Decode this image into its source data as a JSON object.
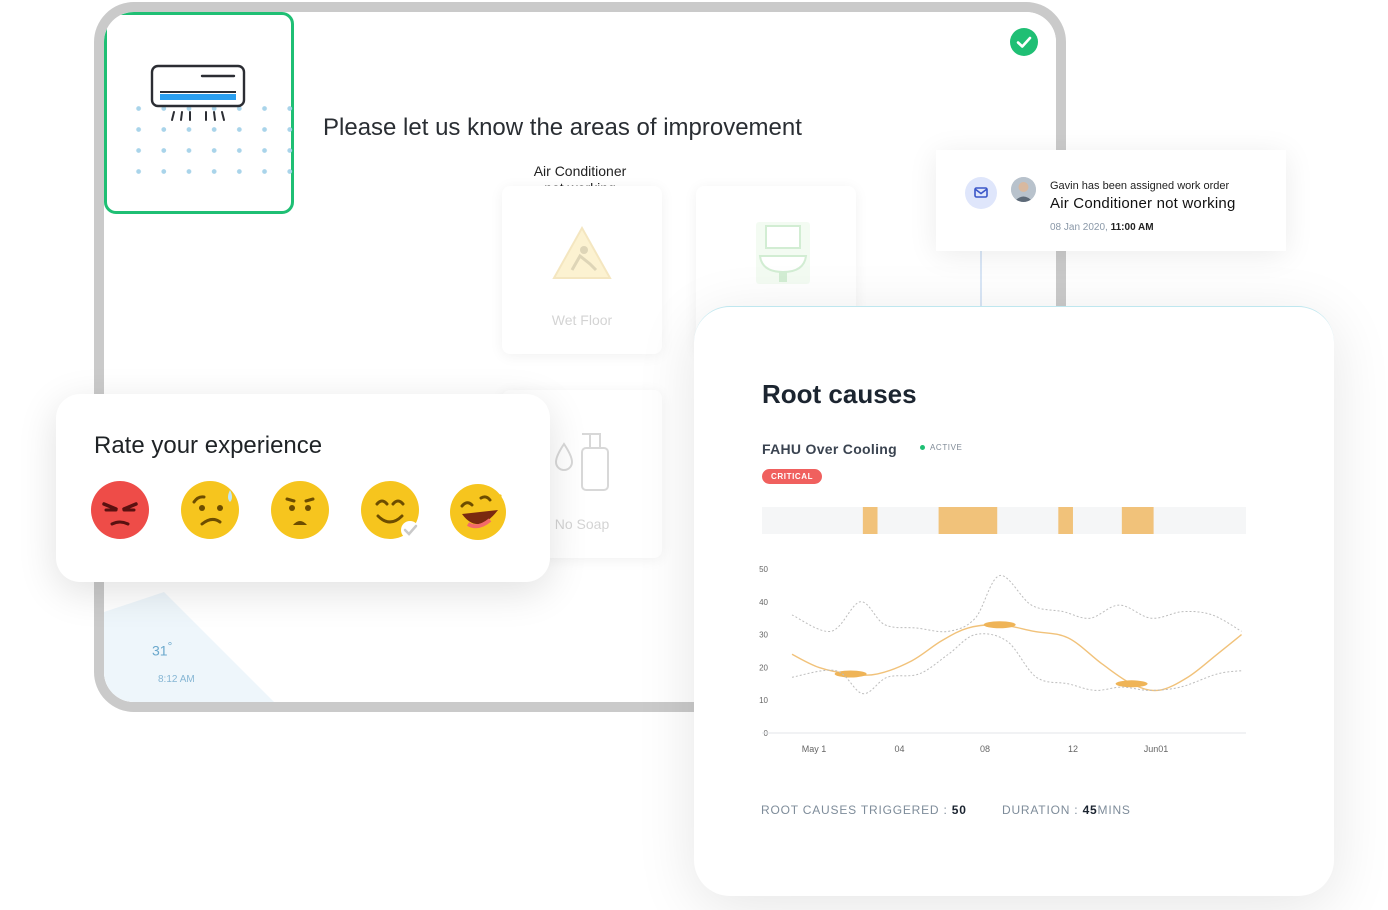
{
  "survey": {
    "title": "Please let us know the areas of improvement",
    "options": [
      {
        "label_line1": "Air Conditioner",
        "label_line2": "not working",
        "selected": true,
        "icon": "air-conditioner-icon"
      },
      {
        "label": "Wet Floor",
        "selected": false,
        "icon": "wet-floor-icon"
      },
      {
        "label": "",
        "selected": false,
        "icon": "sink-icon"
      },
      {
        "label": "No Soap",
        "selected": false,
        "icon": "soap-dispenser-icon"
      }
    ]
  },
  "weather": {
    "temp": "31",
    "degree": "°",
    "time": "8:12 AM"
  },
  "rating": {
    "title": "Rate your experience",
    "options": [
      "angry-face-icon",
      "worried-face-icon",
      "frowning-face-icon",
      "smiling-face-icon",
      "laughing-face-icon"
    ]
  },
  "notification": {
    "subtitle": "Gavin has been assigned work order",
    "title": "Air Conditioner not working",
    "date": "08 Jan 2020,",
    "time": "11:00 AM"
  },
  "root_causes": {
    "title": "Root causes",
    "subtitle": "FAHU Over Cooling",
    "status": "ACTIVE",
    "badge": "CRITICAL",
    "triggered_label": "ROOT CAUSES TRIGGERED : ",
    "triggered_value": "50",
    "duration_label": "DURATION : ",
    "duration_value": "45",
    "duration_unit": "MINS"
  },
  "chart_data": {
    "type": "line",
    "x_tick_labels": [
      "May 1",
      "04",
      "08",
      "12",
      "Jun01"
    ],
    "x_tick_positions": [
      0,
      3.5,
      7,
      10.6,
      14
    ],
    "xlim": [
      -0.9,
      17.6
    ],
    "ylim": [
      0,
      50
    ],
    "y_ticks": [
      0,
      10,
      20,
      30,
      40,
      50
    ],
    "series": [
      {
        "role": "value",
        "x": [
          -0.9,
          0.2,
          1.5,
          2.6,
          4.0,
          5.2,
          6.3,
          7.6,
          9.0,
          10.4,
          11.8,
          13.0,
          14.1,
          15.3,
          16.5,
          17.5
        ],
        "y": [
          24,
          20,
          18,
          18,
          22,
          28,
          32,
          33,
          31,
          29,
          21,
          15,
          13,
          17,
          24,
          30
        ]
      },
      {
        "role": "upper",
        "x": [
          -0.9,
          0.7,
          1.9,
          2.9,
          4.2,
          5.5,
          6.6,
          7.6,
          8.9,
          10.2,
          11.3,
          12.5,
          13.8,
          15.1,
          16.3,
          17.5
        ],
        "y": [
          36,
          31,
          40,
          33,
          32,
          31,
          35,
          48,
          39,
          37,
          35,
          39,
          35,
          37,
          36,
          31
        ]
      },
      {
        "role": "lower",
        "x": [
          -0.9,
          0.9,
          2.0,
          3.0,
          4.3,
          5.5,
          6.6,
          7.9,
          9.1,
          10.4,
          11.5,
          12.6,
          13.7,
          15.0,
          16.5,
          17.5
        ],
        "y": [
          17,
          19,
          12,
          17,
          18,
          24,
          30,
          28,
          17,
          15,
          13,
          14,
          13,
          14,
          18,
          19
        ]
      }
    ],
    "events": [
      [
        2.0,
        2.6
      ],
      [
        5.1,
        7.5
      ],
      [
        10.0,
        10.6
      ],
      [
        12.6,
        13.9
      ]
    ],
    "grid": false
  },
  "colors": {
    "accent_green": "#1fbf74",
    "chart_orange": "#f1c27a",
    "critical_red": "#f0605e"
  }
}
